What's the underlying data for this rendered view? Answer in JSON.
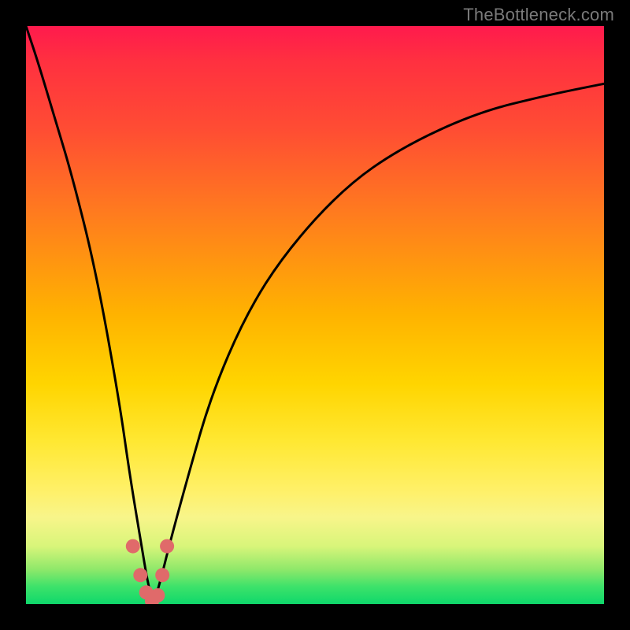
{
  "attribution": "TheBottleneck.com",
  "colors": {
    "top": "#ff1a4d",
    "mid_high": "#ff7a1f",
    "mid": "#ffd500",
    "low": "#0fd86b",
    "curve": "#000000",
    "dots": "#e06a6a",
    "bg": "#000000"
  },
  "chart_data": {
    "type": "line",
    "title": "",
    "xlabel": "",
    "ylabel": "",
    "xlim": [
      0,
      100
    ],
    "ylim": [
      0,
      100
    ],
    "note": "V-shaped bottleneck curve; minimum (zero) around x≈22. Left branch descends steeply from top-left corner to the minimum; right branch rises with decreasing slope toward the upper-right. Values below are approximate y (as % of plot height from bottom) at sampled x (as % of plot width).",
    "series": [
      {
        "name": "curve",
        "x": [
          0,
          2,
          5,
          8,
          12,
          16,
          18,
          20,
          21,
          22,
          23,
          25,
          28,
          32,
          38,
          45,
          55,
          65,
          78,
          90,
          100
        ],
        "y": [
          100,
          94,
          84,
          74,
          58,
          36,
          22,
          10,
          4,
          0,
          3,
          11,
          22,
          36,
          50,
          61,
          72,
          79,
          85,
          88,
          90
        ]
      }
    ],
    "markers": {
      "name": "highlight-dots",
      "x": [
        18.5,
        19.8,
        20.8,
        21.8,
        22.8,
        23.6,
        24.4
      ],
      "y": [
        10,
        5,
        2,
        0.5,
        1.5,
        5,
        10
      ]
    }
  }
}
